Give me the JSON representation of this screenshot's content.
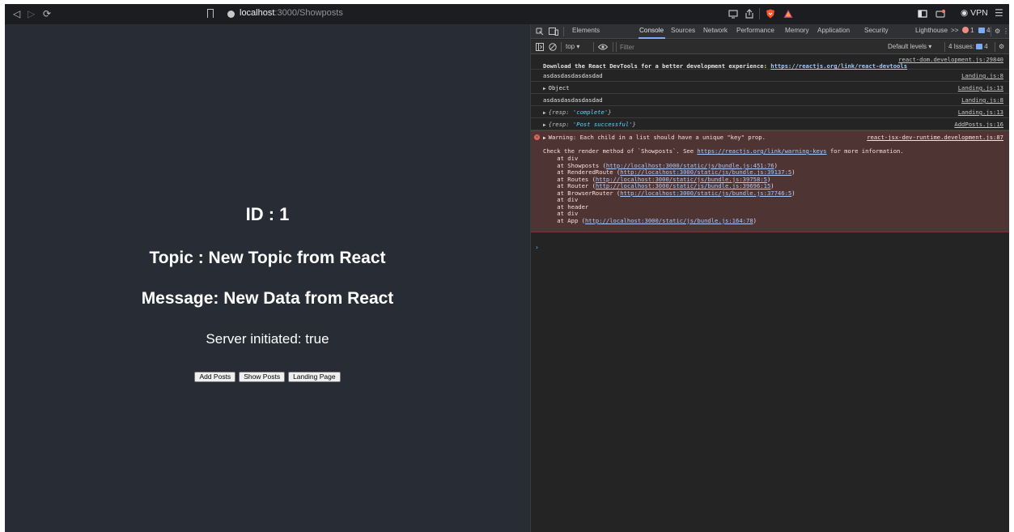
{
  "browser": {
    "url_host": "localhost",
    "url_path": ":3000/Showposts",
    "vpn_label": "VPN",
    "icons": [
      "back-icon",
      "forward-icon",
      "reload-icon",
      "bookmark-icon",
      "site-info-icon",
      "cast-icon",
      "share-icon",
      "brave-shield-icon",
      "brave-rewards-icon",
      "sidebar-icon",
      "wallet-icon",
      "vpn-icon",
      "menu-icon"
    ]
  },
  "page": {
    "id_line": "ID : 1",
    "topic_line": "Topic : New Topic from React",
    "message_line": "Message: New Data from React",
    "server_line": "Server initiated: true",
    "buttons": [
      "Add Posts",
      "Show Posts",
      "Landing Page"
    ]
  },
  "devtools": {
    "tabs": [
      "Elements",
      "Console",
      "Sources",
      "Network",
      "Performance",
      "Memory",
      "Application",
      "Security",
      "Lighthouse"
    ],
    "active_tab": "Console",
    "more_tabs": ">>",
    "error_count": "1",
    "info_count": "4",
    "toolbar": {
      "context": "top",
      "filter_placeholder": "Filter",
      "levels": "Default levels",
      "issues_label": "4 Issues:",
      "issues_count": "4"
    },
    "console": {
      "react_src": "react-dom.development.js:29840",
      "react_msg_prefix": "Download the React DevTools for a better development experience: ",
      "react_msg_link": "https://reactjs.org/link/react-devtools",
      "row1_text": "asdasdasdasdasdad",
      "row1_src": "Landing.js:8",
      "row2_text": "Object",
      "row2_src": "Landing.js:13",
      "row3_text": "asdasdasdasdasdad",
      "row3_src": "Landing.js:8",
      "row4_key": "{resp: ",
      "row4_val": "'complete'",
      "row4_end": "}",
      "row4_src": "Landing.js:13",
      "row5_key": "{resp: ",
      "row5_val": "'Post successful'",
      "row5_end": "}",
      "row5_src": "AddPosts.js:16",
      "warning": {
        "text": "Warning: Each child in a list should have a unique \"key\" prop.",
        "src": "react-jsx-dev-runtime.development.js:87",
        "check_prefix": "Check the render method of `Showposts`. See ",
        "check_link": "https://reactjs.org/link/warning-keys",
        "check_suffix": " for more information.",
        "stack": [
          {
            "pre": "    at div",
            "link": "",
            "post": ""
          },
          {
            "pre": "    at Showposts (",
            "link": "http://localhost:3000/static/js/bundle.js:451:76",
            "post": ")"
          },
          {
            "pre": "    at RenderedRoute (",
            "link": "http://localhost:3000/static/js/bundle.js:39137:5",
            "post": ")"
          },
          {
            "pre": "    at Routes (",
            "link": "http://localhost:3000/static/js/bundle.js:39758:5",
            "post": ")"
          },
          {
            "pre": "    at Router (",
            "link": "http://localhost:3000/static/js/bundle.js:39696:15",
            "post": ")"
          },
          {
            "pre": "    at BrowserRouter (",
            "link": "http://localhost:3000/static/js/bundle.js:37746:5",
            "post": ")"
          },
          {
            "pre": "    at div",
            "link": "",
            "post": ""
          },
          {
            "pre": "    at header",
            "link": "",
            "post": ""
          },
          {
            "pre": "    at div",
            "link": "",
            "post": ""
          },
          {
            "pre": "    at App (",
            "link": "http://localhost:3000/static/js/bundle.js:164:78",
            "post": ")"
          }
        ]
      },
      "prompt": "›"
    }
  },
  "colors": {
    "page_bg": "#282c34",
    "devtools_bg": "#242424",
    "error_bg": "#4e3534",
    "link": "#a8c7fa",
    "accent_blue": "#7cacf8"
  }
}
